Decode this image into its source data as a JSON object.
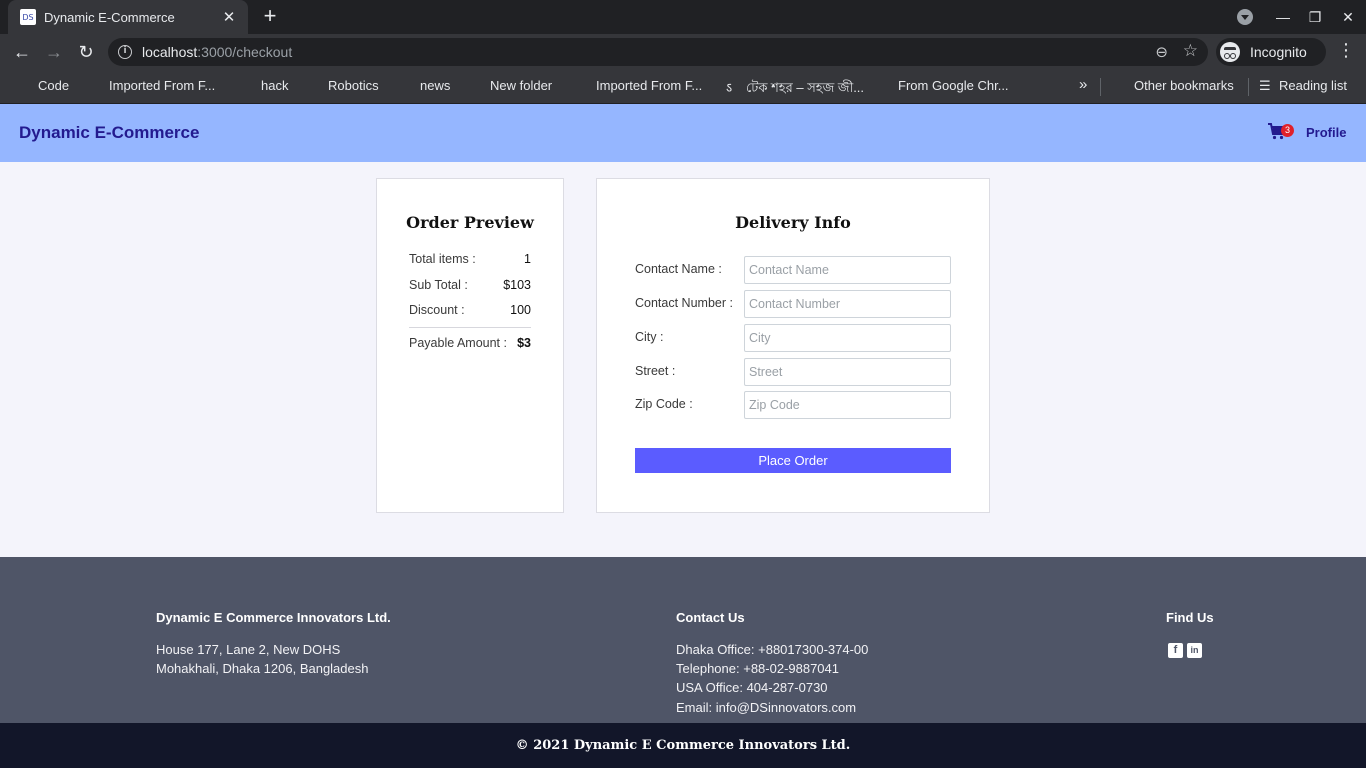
{
  "browser": {
    "tab_title": "Dynamic E-Commerce",
    "tab_favicon": "DS",
    "new_tab_glyph": "+",
    "url_host": "localhost",
    "url_path": ":3000/checkout",
    "incognito_label": "Incognito",
    "bookmarks": [
      {
        "label": "Code"
      },
      {
        "label": "Imported From F..."
      },
      {
        "label": "hack"
      },
      {
        "label": "Robotics"
      },
      {
        "label": "news"
      },
      {
        "label": "New folder"
      },
      {
        "label": "Imported From F..."
      },
      {
        "label": "টেক শহর – সহজ জী..."
      },
      {
        "label": "From Google Chr..."
      }
    ],
    "bookmarks_more": "»",
    "other_bookmarks": "Other bookmarks",
    "reading_list": "Reading list"
  },
  "header": {
    "brand": "Dynamic E-Commerce",
    "cart_count": "3",
    "profile_label": "Profile"
  },
  "order_preview": {
    "title": "Order Preview",
    "total_items_label": "Total items :",
    "total_items_value": "1",
    "subtotal_label": "Sub Total :",
    "subtotal_value": "$103",
    "discount_label": "Discount :",
    "discount_value": "100",
    "payable_label": "Payable Amount :",
    "payable_value": "$3"
  },
  "delivery": {
    "title": "Delivery Info",
    "fields": [
      {
        "label": "Contact Name :",
        "placeholder": "Contact Name",
        "value": ""
      },
      {
        "label": "Contact Number :",
        "placeholder": "Contact Number",
        "value": ""
      },
      {
        "label": "City :",
        "placeholder": "City",
        "value": ""
      },
      {
        "label": "Street :",
        "placeholder": "Street",
        "value": ""
      },
      {
        "label": "Zip Code :",
        "placeholder": "Zip Code",
        "value": ""
      }
    ],
    "submit_label": "Place Order"
  },
  "footer": {
    "company": {
      "name": "Dynamic E Commerce Innovators Ltd.",
      "address_line1": "House 177, Lane 2, New DOHS",
      "address_line2": "Mohakhali, Dhaka 1206, Bangladesh"
    },
    "contact": {
      "heading": "Contact Us",
      "dhaka_office": "Dhaka Office: +88017300-374-00",
      "telephone": "Telephone: +88-02-9887041",
      "usa_office": "USA Office: 404-287-0730",
      "email": "Email: info@DSinnovators.com"
    },
    "find_us": {
      "heading": "Find Us",
      "icons": [
        "facebook-icon",
        "linkedin-icon"
      ]
    },
    "copyright": "© 2021 Dynamic E Commerce Innovators Ltd."
  },
  "colors": {
    "header_bg": "#95b6ff",
    "brand_text": "#231a8f",
    "button_bg": "#5b5cff",
    "footer_bg": "#4f5567",
    "copyright_bg": "#121629",
    "badge": "#e0202a"
  }
}
